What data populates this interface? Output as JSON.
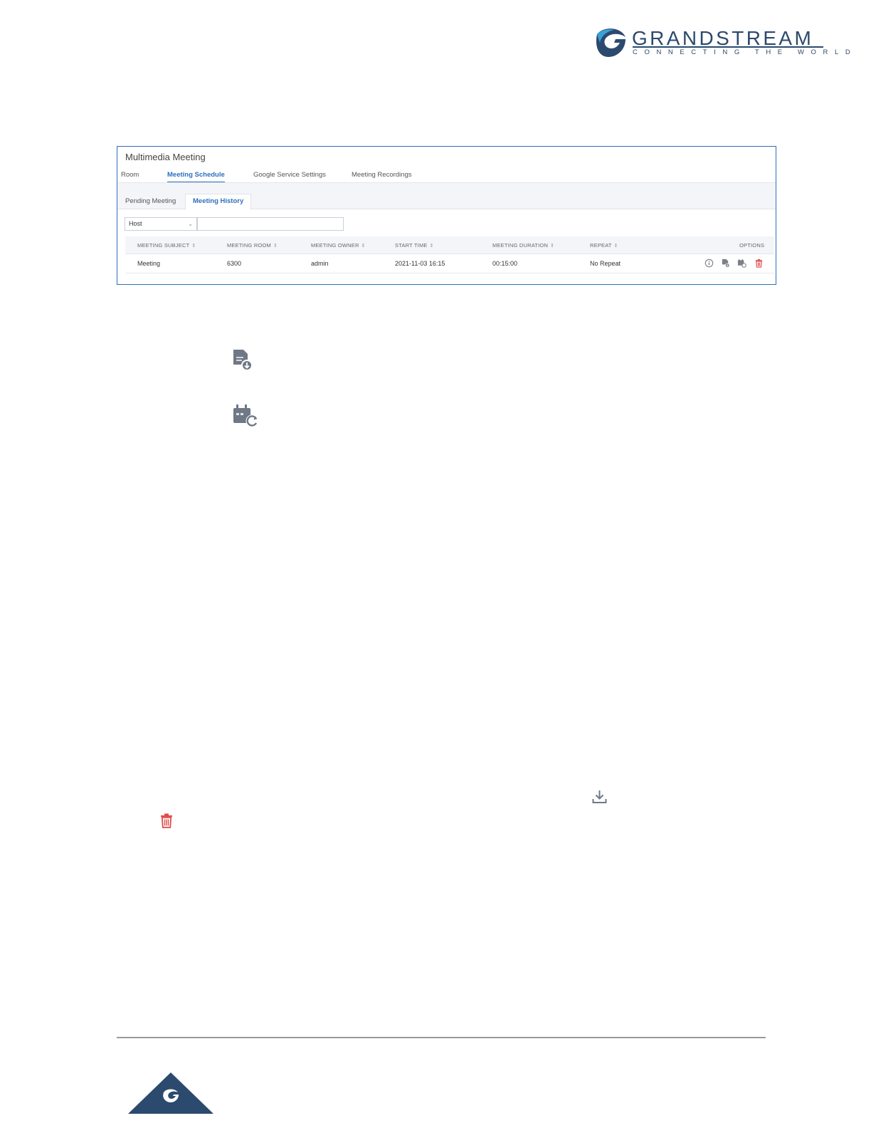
{
  "brand": {
    "name": "GRANDSTREAM",
    "tagline": "CONNECTING THE WORLD",
    "color": "#2c4a6e"
  },
  "panel": {
    "title": "Multimedia Meeting",
    "main_tabs": [
      "Room",
      "Meeting Schedule",
      "Google Service Settings",
      "Meeting Recordings"
    ],
    "active_main_tab": "Meeting Schedule",
    "sub_tabs": [
      "Pending Meeting",
      "Meeting History"
    ],
    "active_sub_tab": "Meeting History",
    "filter": {
      "selected": "Host",
      "search_value": ""
    },
    "table": {
      "columns": [
        "MEETING SUBJECT",
        "MEETING ROOM",
        "MEETING OWNER",
        "START TIME",
        "MEETING DURATION",
        "REPEAT",
        "OPTIONS"
      ],
      "rows": [
        {
          "subject": "Meeting",
          "room": "6300",
          "owner": "admin",
          "start_time": "2021-11-03 16:15",
          "duration": "00:15:00",
          "repeat": "No Repeat",
          "options": [
            "info-icon",
            "report-download-icon",
            "reschedule-icon",
            "delete-icon"
          ]
        }
      ]
    },
    "accent_color": "#2e6fbd",
    "danger_color": "#e04a4a"
  },
  "page_icons": [
    "report-download-icon",
    "reschedule-icon",
    "download-icon",
    "delete-icon"
  ]
}
